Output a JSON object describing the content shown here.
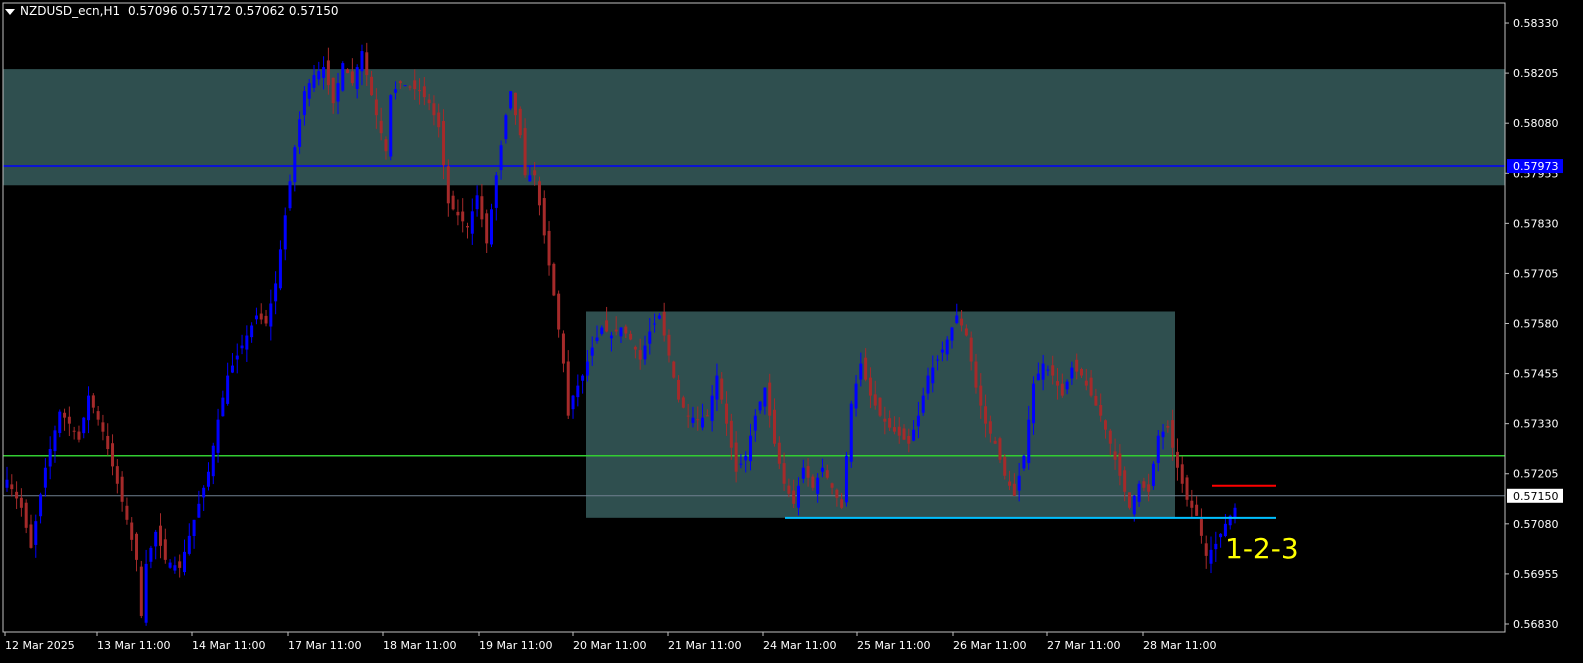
{
  "header": {
    "symbol": "NZDUSD_ecn,H1",
    "open": "0.57096",
    "high": "0.57172",
    "low": "0.57062",
    "close": "0.57150"
  },
  "colors": {
    "background": "#000000",
    "axis": "#c0c0c0",
    "bull_candle": "#0000ff",
    "bear_candle": "#a52a2a",
    "zone_fill": "#2f4f4f",
    "resistance_line": "#0000ff",
    "support_line": "#32cd32",
    "current_price_line": "#708090",
    "range_low_line": "#00bfff",
    "entry_line": "#ff0000",
    "annotation": "#ffff00"
  },
  "chart_data": {
    "type": "candlestick",
    "y_ticks": [
      "0.58330",
      "0.58205",
      "0.58080",
      "0.57955",
      "0.57830",
      "0.57705",
      "0.57580",
      "0.57455",
      "0.57330",
      "0.57205",
      "0.57080",
      "0.56955",
      "0.56830"
    ],
    "y_range": [
      0.5681,
      0.5838
    ],
    "x_ticks": [
      "12 Mar 2025",
      "13 Mar 11:00",
      "14 Mar 11:00",
      "17 Mar 11:00",
      "18 Mar 11:00",
      "19 Mar 11:00",
      "20 Mar 11:00",
      "21 Mar 11:00",
      "24 Mar 11:00",
      "25 Mar 11:00",
      "26 Mar 11:00",
      "27 Mar 11:00",
      "28 Mar 11:00"
    ],
    "price_labels": {
      "current": "0.57150",
      "resistance": "0.57973"
    },
    "levels": {
      "current_price": 0.5715,
      "resistance_line": 0.57973,
      "support_line": 0.5725,
      "range_low": 0.57095,
      "entry": 0.57175
    },
    "zones": [
      {
        "name": "upper-zone",
        "top": 0.58215,
        "bottom": 0.57925
      },
      {
        "name": "consolidation-zone",
        "top": 0.5761,
        "bottom": 0.57095
      }
    ],
    "annotation": "1-2-3",
    "path_points": [
      [
        0,
        0.5719
      ],
      [
        3,
        0.5712
      ],
      [
        5,
        0.5702
      ],
      [
        8,
        0.5722
      ],
      [
        11,
        0.5736
      ],
      [
        13,
        0.5733
      ],
      [
        15,
        0.5729
      ],
      [
        17,
        0.574
      ],
      [
        20,
        0.5731
      ],
      [
        23,
        0.5718
      ],
      [
        25,
        0.5709
      ],
      [
        27,
        0.5699
      ],
      [
        28,
        0.5685
      ],
      [
        29,
        0.5698
      ],
      [
        31,
        0.5706
      ],
      [
        33,
        0.5699
      ],
      [
        36,
        0.5697
      ],
      [
        38,
        0.5705
      ],
      [
        40,
        0.5713
      ],
      [
        42,
        0.5721
      ],
      [
        44,
        0.5734
      ],
      [
        46,
        0.5745
      ],
      [
        48,
        0.575
      ],
      [
        50,
        0.5755
      ],
      [
        52,
        0.576
      ],
      [
        54,
        0.5758
      ],
      [
        56,
        0.5768
      ],
      [
        58,
        0.5785
      ],
      [
        60,
        0.5802
      ],
      [
        62,
        0.5816
      ],
      [
        64,
        0.582
      ],
      [
        66,
        0.5822
      ],
      [
        68,
        0.5813
      ],
      [
        70,
        0.5823
      ],
      [
        72,
        0.5818
      ],
      [
        74,
        0.5826
      ],
      [
        75,
        0.582
      ],
      [
        77,
        0.581
      ],
      [
        79,
        0.5801
      ],
      [
        80,
        0.5815
      ],
      [
        82,
        0.5818
      ],
      [
        84,
        0.5817
      ],
      [
        86,
        0.5816
      ],
      [
        88,
        0.5813
      ],
      [
        90,
        0.5807
      ],
      [
        92,
        0.5788
      ],
      [
        94,
        0.5785
      ],
      [
        96,
        0.5782
      ],
      [
        98,
        0.579
      ],
      [
        100,
        0.5778
      ],
      [
        102,
        0.5795
      ],
      [
        104,
        0.581
      ],
      [
        105,
        0.5816
      ],
      [
        106,
        0.581
      ],
      [
        107,
        0.5805
      ],
      [
        108,
        0.5795
      ],
      [
        110,
        0.5795
      ],
      [
        112,
        0.578
      ],
      [
        114,
        0.5765
      ],
      [
        116,
        0.5748
      ],
      [
        117,
        0.5735
      ],
      [
        118,
        0.574
      ],
      [
        120,
        0.5745
      ],
      [
        122,
        0.5752
      ],
      [
        124,
        0.5757
      ],
      [
        126,
        0.5755
      ],
      [
        128,
        0.5757
      ],
      [
        130,
        0.5754
      ],
      [
        132,
        0.5749
      ],
      [
        134,
        0.5756
      ],
      [
        136,
        0.576
      ],
      [
        138,
        0.575
      ],
      [
        140,
        0.5739
      ],
      [
        142,
        0.5735
      ],
      [
        144,
        0.5734
      ],
      [
        146,
        0.5735
      ],
      [
        148,
        0.5745
      ],
      [
        150,
        0.5733
      ],
      [
        152,
        0.5721
      ],
      [
        154,
        0.5725
      ],
      [
        156,
        0.5735
      ],
      [
        158,
        0.5742
      ],
      [
        160,
        0.5728
      ],
      [
        162,
        0.5718
      ],
      [
        164,
        0.5713
      ],
      [
        166,
        0.5722
      ],
      [
        168,
        0.5717
      ],
      [
        170,
        0.5722
      ],
      [
        172,
        0.5717
      ],
      [
        174,
        0.5712
      ],
      [
        176,
        0.5738
      ],
      [
        178,
        0.5748
      ],
      [
        180,
        0.574
      ],
      [
        182,
        0.5735
      ],
      [
        184,
        0.5732
      ],
      [
        186,
        0.573
      ],
      [
        188,
        0.5728
      ],
      [
        190,
        0.5735
      ],
      [
        192,
        0.5745
      ],
      [
        194,
        0.5749
      ],
      [
        196,
        0.5754
      ],
      [
        198,
        0.576
      ],
      [
        200,
        0.5755
      ],
      [
        202,
        0.5742
      ],
      [
        204,
        0.5733
      ],
      [
        206,
        0.5728
      ],
      [
        208,
        0.572
      ],
      [
        210,
        0.5715
      ],
      [
        212,
        0.5725
      ],
      [
        214,
        0.5743
      ],
      [
        216,
        0.5748
      ],
      [
        218,
        0.5745
      ],
      [
        220,
        0.574
      ],
      [
        222,
        0.5747
      ],
      [
        224,
        0.5745
      ],
      [
        226,
        0.574
      ],
      [
        228,
        0.5735
      ],
      [
        230,
        0.5728
      ],
      [
        232,
        0.572
      ],
      [
        234,
        0.5712
      ],
      [
        236,
        0.5718
      ],
      [
        238,
        0.5716
      ],
      [
        240,
        0.573
      ],
      [
        242,
        0.5732
      ],
      [
        244,
        0.5722
      ],
      [
        246,
        0.5714
      ],
      [
        248,
        0.571
      ],
      [
        250,
        0.57
      ],
      [
        252,
        0.5703
      ],
      [
        254,
        0.5708
      ],
      [
        256,
        0.5712
      ]
    ]
  }
}
